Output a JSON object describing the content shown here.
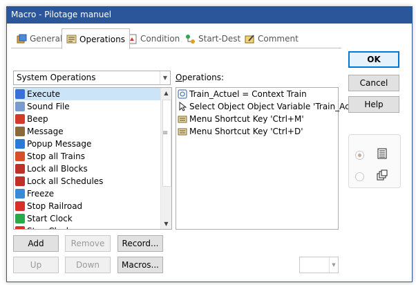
{
  "window": {
    "title": "Macro - Pilotage manuel"
  },
  "tabs": [
    {
      "label": "General",
      "icon": "general-icon"
    },
    {
      "label": "Operations",
      "icon": "operations-icon"
    },
    {
      "label": "Condition",
      "icon": "condition-icon"
    },
    {
      "label": "Start-Dest",
      "icon": "start-dest-icon"
    },
    {
      "label": "Comment",
      "icon": "comment-icon"
    }
  ],
  "category_select": {
    "value": "System Operations"
  },
  "operations_label": "Operations:",
  "available_list": {
    "items": [
      {
        "label": "Execute",
        "icon": "execute-icon",
        "color": "#3a6fd8"
      },
      {
        "label": "Sound File",
        "icon": "sound-file-icon",
        "color": "#7a9ad0"
      },
      {
        "label": "Beep",
        "icon": "beep-icon",
        "color": "#d23a2a"
      },
      {
        "label": "Message",
        "icon": "message-icon",
        "color": "#8a6a3a"
      },
      {
        "label": "Popup Message",
        "icon": "popup-message-icon",
        "color": "#2a7ad8"
      },
      {
        "label": "Stop all Trains",
        "icon": "stop-trains-icon",
        "color": "#d8502a"
      },
      {
        "label": "Lock all Blocks",
        "icon": "lock-blocks-icon",
        "color": "#c0302a"
      },
      {
        "label": "Lock all Schedules",
        "icon": "lock-schedules-icon",
        "color": "#c0302a"
      },
      {
        "label": "Freeze",
        "icon": "freeze-icon",
        "color": "#3a8ad8"
      },
      {
        "label": "Stop Railroad",
        "icon": "stop-railroad-icon",
        "color": "#d8302a"
      },
      {
        "label": "Start Clock",
        "icon": "start-clock-icon",
        "color": "#2aa84a"
      },
      {
        "label": "Stop Clock",
        "icon": "stop-clock-icon",
        "color": "#d8302a"
      }
    ]
  },
  "operations_list": {
    "items": [
      {
        "label": "Train_Actuel = Context Train",
        "icon": "variable-icon"
      },
      {
        "label": "Select Object Object Variable 'Train_Actuel'",
        "icon": "cursor-icon"
      },
      {
        "label": "Menu Shortcut Key 'Ctrl+M'",
        "icon": "keyboard-icon"
      },
      {
        "label": "Menu Shortcut Key 'Ctrl+D'",
        "icon": "keyboard-icon"
      }
    ]
  },
  "buttons": {
    "add": "Add",
    "remove": "Remove",
    "record": "Record...",
    "up": "Up",
    "down": "Down",
    "macros": "Macros...",
    "ok": "OK",
    "cancel": "Cancel",
    "help": "Help"
  },
  "colors": {
    "titlebar": "#2b579a",
    "accent": "#0078d7",
    "selection": "#cce4f7"
  }
}
